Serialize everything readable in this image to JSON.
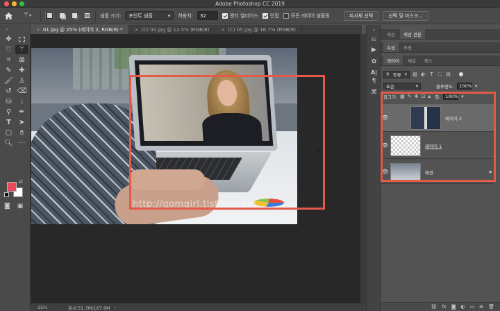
{
  "app": {
    "title": "Adobe Photoshop CC 2019"
  },
  "options_bar": {
    "sample_size_label": "샘플 크기:",
    "sample_size_value": "포인트 샘플",
    "tolerance_label": "허용치:",
    "tolerance_value": "32",
    "antialias_label": "앤티 앨리어스",
    "contiguous_label": "인접",
    "sample_all_label": "모든 레이어 샘플링",
    "select_subject_label": "피사체 선택",
    "select_mask_label": "선택 및 마스크..."
  },
  "tabs": [
    {
      "label": "01.jpg @ 25% (레이어 2, RGB/8) *",
      "active": true
    },
    {
      "label": "(C) 04.jpg @ 12.5% (RGB/8)",
      "active": false
    },
    {
      "label": "(C) 05.jpg @ 16.7% (RGB/8)",
      "active": false
    }
  ],
  "canvas": {
    "watermark": "http://gomgirl.tistory.com"
  },
  "status": {
    "zoom": "25%",
    "doc_size": "문서:51.3M/167.9M"
  },
  "panels": {
    "top_tabs": [
      {
        "label": "색상",
        "active": false
      },
      {
        "label": "색상 견본",
        "active": true
      }
    ],
    "mid_tabs": [
      {
        "label": "속성",
        "active": true
      },
      {
        "label": "조정",
        "active": false
      }
    ],
    "layer_tabs": [
      {
        "label": "레이어",
        "active": true
      },
      {
        "label": "채널",
        "active": false
      },
      {
        "label": "패스",
        "active": false
      }
    ],
    "filter_label": "종류",
    "blend_mode": "표준",
    "opacity_label": "불투명도:",
    "opacity_value": "100%",
    "lock_label": "잠그기:",
    "fill_label": "칠:",
    "fill_value": "100%",
    "layers": [
      {
        "name": "레이어 2"
      },
      {
        "name": "레이어 1"
      },
      {
        "name": "배경"
      }
    ]
  },
  "colors": {
    "foreground": "#e94a5b",
    "background": "#ffffff",
    "highlight": "#e35a48"
  }
}
